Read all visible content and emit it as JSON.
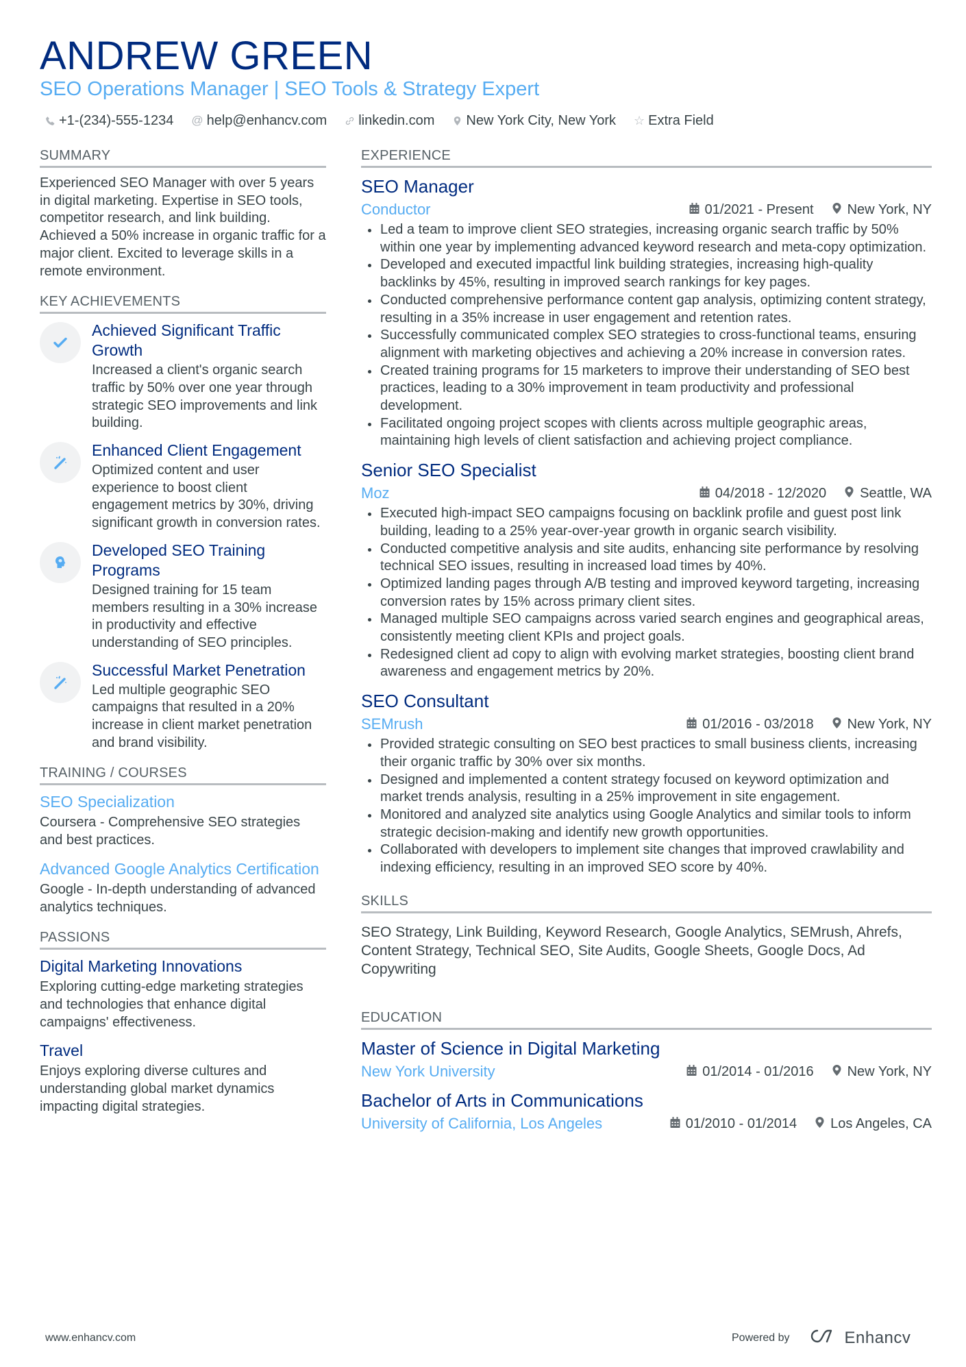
{
  "header": {
    "name": "ANDREW GREEN",
    "subtitle": "SEO Operations Manager | SEO Tools & Strategy Expert",
    "contacts": [
      {
        "icon": "phone-icon",
        "text": "+1-(234)-555-1234"
      },
      {
        "icon": "at-icon",
        "text": "help@enhancv.com"
      },
      {
        "icon": "link-icon",
        "text": "linkedin.com"
      },
      {
        "icon": "location-pin-icon",
        "text": "New York City, New York"
      },
      {
        "icon": "star-icon",
        "text": "Extra Field"
      }
    ]
  },
  "summary": {
    "title": "SUMMARY",
    "text": "Experienced SEO Manager with over 5 years in digital marketing. Expertise in SEO tools, competitor research, and link building. Achieved a 50% increase in organic traffic for a major client. Excited to leverage skills in a remote environment."
  },
  "achievements": {
    "title": "KEY ACHIEVEMENTS",
    "items": [
      {
        "icon": "checkmark-icon",
        "title": "Achieved Significant Traffic Growth",
        "text": "Increased a client's organic search traffic by 50% over one year through strategic SEO improvements and link building."
      },
      {
        "icon": "magic-wand-icon",
        "title": "Enhanced Client Engagement",
        "text": "Optimized content and user experience to boost client engagement metrics by 30%, driving significant growth in conversion rates."
      },
      {
        "icon": "head-brain-icon",
        "title": "Developed SEO Training Programs",
        "text": "Designed training for 15 team members resulting in a 30% increase in productivity and effective understanding of SEO principles."
      },
      {
        "icon": "magic-wand-icon",
        "title": "Successful Market Penetration",
        "text": "Led multiple geographic SEO campaigns that resulted in a 20% increase in client market penetration and brand visibility."
      }
    ]
  },
  "training": {
    "title": "TRAINING / COURSES",
    "items": [
      {
        "title": "SEO Specialization",
        "text": "Coursera - Comprehensive SEO strategies and best practices."
      },
      {
        "title": "Advanced Google Analytics Certification",
        "text": "Google - In-depth understanding of advanced analytics techniques."
      }
    ]
  },
  "passions": {
    "title": "PASSIONS",
    "items": [
      {
        "title": "Digital Marketing Innovations",
        "text": "Exploring cutting-edge marketing strategies and technologies that enhance digital campaigns' effectiveness."
      },
      {
        "title": "Travel",
        "text": "Enjoys exploring diverse cultures and understanding global market dynamics impacting digital strategies."
      }
    ]
  },
  "experience": {
    "title": "EXPERIENCE",
    "jobs": [
      {
        "title": "SEO Manager",
        "company": "Conductor",
        "dates": "01/2021 - Present",
        "location": "New York, NY",
        "bullets": [
          "Led a team to improve client SEO strategies, increasing organic search traffic by 50% within one year by implementing advanced keyword research and meta-copy optimization.",
          "Developed and executed impactful link building strategies, increasing high-quality backlinks by 45%, resulting in improved search rankings for key pages.",
          "Conducted comprehensive performance content gap analysis, optimizing content strategy, resulting in a 35% increase in user engagement and retention rates.",
          "Successfully communicated complex SEO strategies to cross-functional teams, ensuring alignment with marketing objectives and achieving a 20% increase in conversion rates.",
          "Created training programs for 15 marketers to improve their understanding of SEO best practices, leading to a 30% improvement in team productivity and professional development.",
          "Facilitated ongoing project scopes with clients across multiple geographic areas, maintaining high levels of client satisfaction and achieving project compliance."
        ]
      },
      {
        "title": "Senior SEO Specialist",
        "company": "Moz",
        "dates": "04/2018 - 12/2020",
        "location": "Seattle, WA",
        "bullets": [
          "Executed high-impact SEO campaigns focusing on backlink profile and guest post link building, leading to a 25% year-over-year growth in organic search visibility.",
          "Conducted competitive analysis and site audits, enhancing site performance by resolving technical SEO issues, resulting in increased load times by 40%.",
          "Optimized landing pages through A/B testing and improved keyword targeting, increasing conversion rates by 15% across primary client sites.",
          "Managed multiple SEO campaigns across varied search engines and geographical areas, consistently meeting client KPIs and project goals.",
          "Redesigned client ad copy to align with evolving market strategies, boosting client brand awareness and engagement metrics by 20%."
        ]
      },
      {
        "title": "SEO Consultant",
        "company": "SEMrush",
        "dates": "01/2016 - 03/2018",
        "location": "New York, NY",
        "bullets": [
          "Provided strategic consulting on SEO best practices to small business clients, increasing their organic traffic by 30% over six months.",
          "Designed and implemented a content strategy focused on keyword optimization and market trends analysis, resulting in a 25% improvement in site engagement.",
          "Monitored and analyzed site analytics using Google Analytics and similar tools to inform strategic decision-making and identify new growth opportunities.",
          "Collaborated with developers to implement site changes that improved crawlability and indexing efficiency, resulting in an improved SEO score by 40%."
        ]
      }
    ]
  },
  "skills": {
    "title": "SKILLS",
    "text": "SEO Strategy, Link Building, Keyword Research, Google Analytics, SEMrush, Ahrefs, Content Strategy, Technical SEO, Site Audits, Google Sheets, Google Docs, Ad Copywriting"
  },
  "education": {
    "title": "EDUCATION",
    "items": [
      {
        "degree": "Master of Science in Digital Marketing",
        "school": "New York University",
        "dates": "01/2014 - 01/2016",
        "location": "New York, NY"
      },
      {
        "degree": "Bachelor of Arts in Communications",
        "school": "University of California, Los Angeles",
        "dates": "01/2010 - 01/2014",
        "location": "Los Angeles, CA"
      }
    ]
  },
  "footer": {
    "website": "www.enhancv.com",
    "powered_by": "Powered by",
    "brand": "Enhancv"
  },
  "colors": {
    "name": "#002b7f",
    "accent": "#56acf2",
    "text": "#384347",
    "rule": "#b8bcc0"
  }
}
